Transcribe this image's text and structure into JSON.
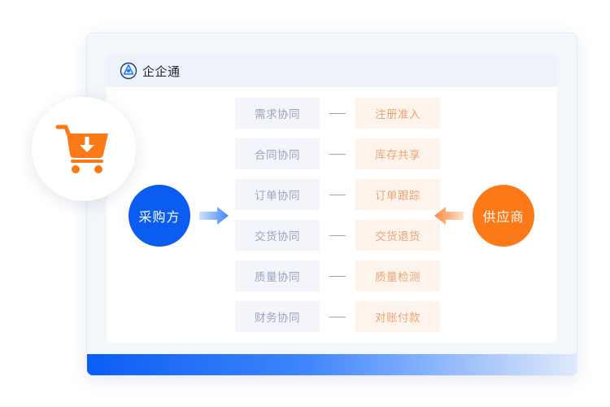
{
  "app": {
    "name": "企企通"
  },
  "buyer": {
    "label": "采购方"
  },
  "supplier": {
    "label": "供应商"
  },
  "rows": [
    {
      "left": "需求协同",
      "right": "注册准入"
    },
    {
      "left": "合同协同",
      "right": "库存共享"
    },
    {
      "left": "订单协同",
      "right": "订单跟踪"
    },
    {
      "left": "交货协同",
      "right": "交货退货"
    },
    {
      "left": "质量协同",
      "right": "质量检测"
    },
    {
      "left": "财务协同",
      "right": "对账付款"
    }
  ],
  "icons": {
    "logo": "logo-icon",
    "cart": "shopping-cart-download-icon",
    "arrow_right": "arrow-right-icon",
    "arrow_left": "arrow-left-icon"
  },
  "colors": {
    "primary_blue": "#0a5df0",
    "accent_orange": "#fb7917",
    "left_box_bg": "#f3f5fa",
    "left_box_text": "#9aa5bd",
    "right_box_bg": "#fff4ec",
    "right_box_text": "#e9a577"
  }
}
